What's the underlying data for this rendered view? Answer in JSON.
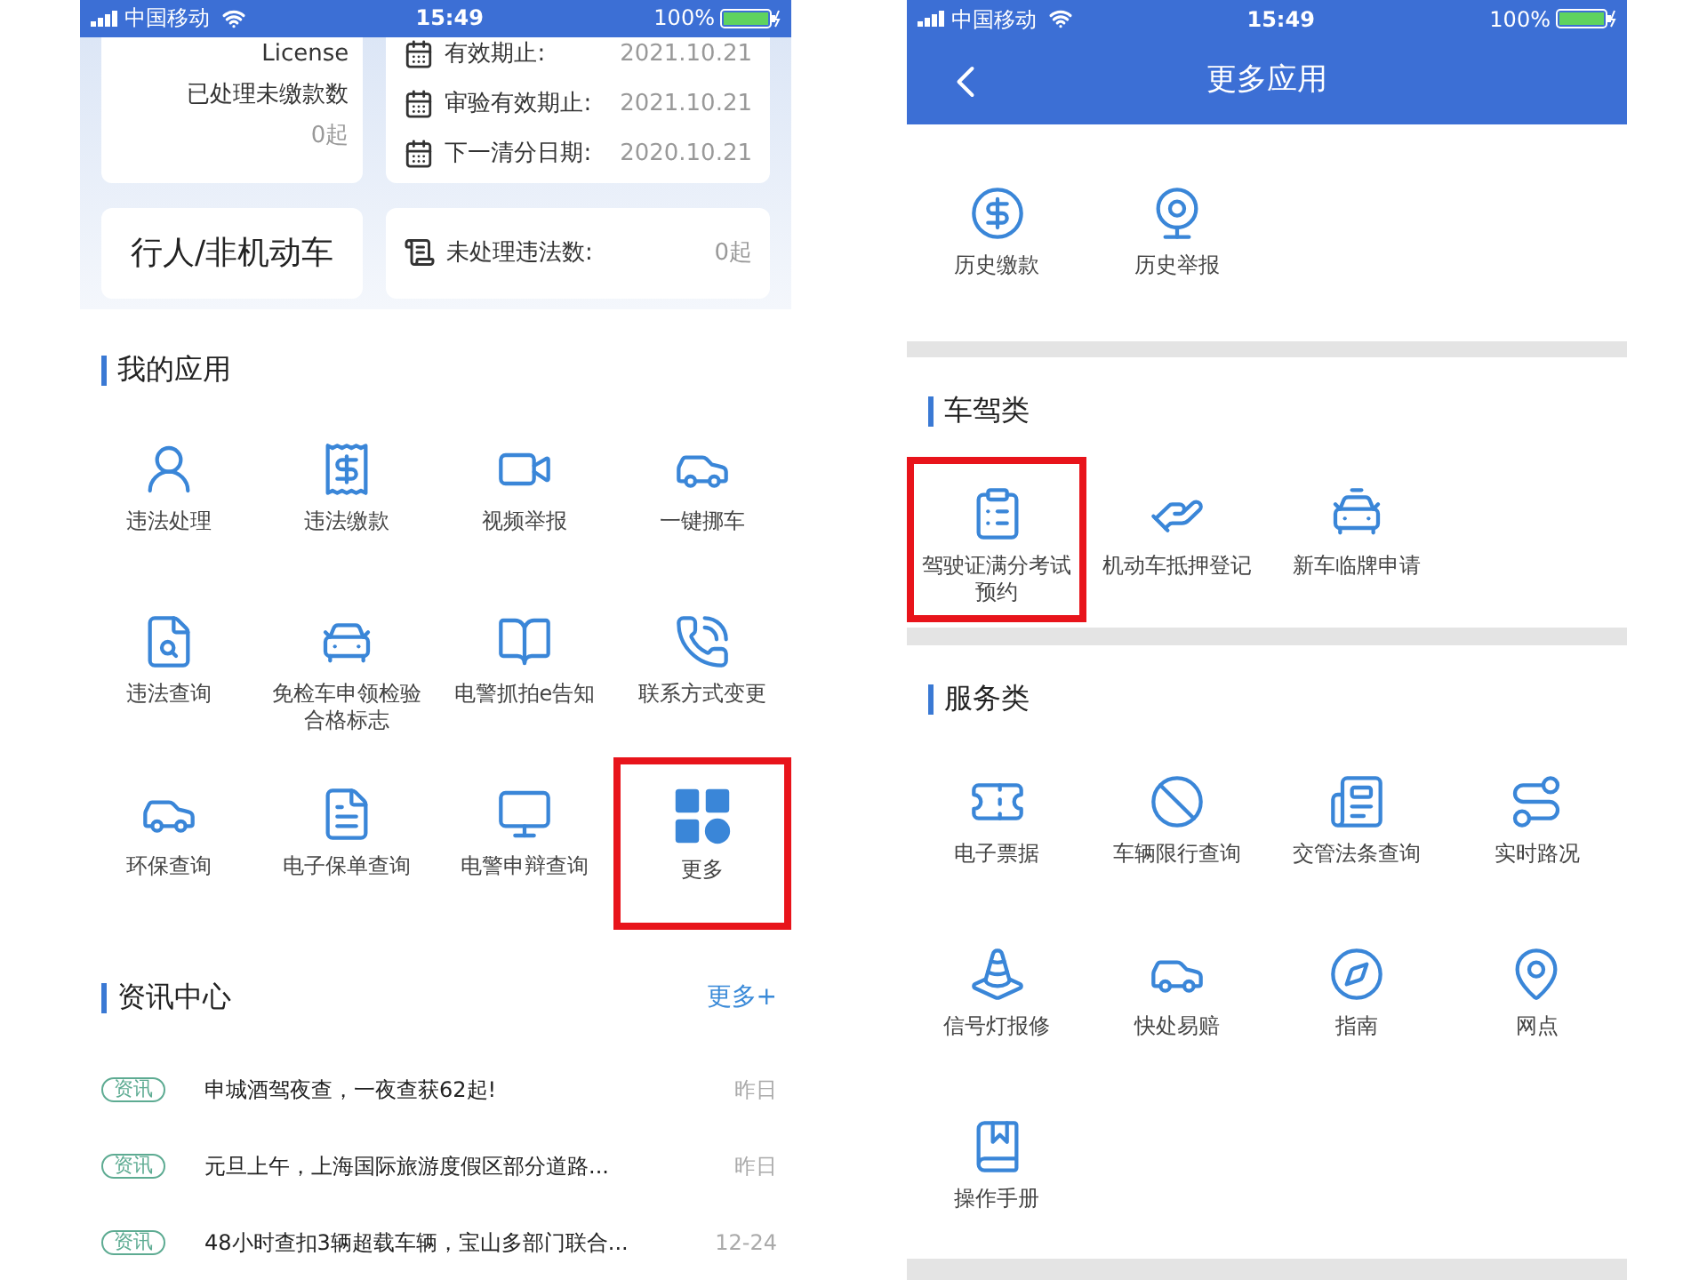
{
  "left_screen": {
    "status_bar": {
      "carrier": "中国移动",
      "time": "15:49",
      "battery": "100%"
    },
    "license_card": {
      "title": "License",
      "label": "已处理未缴款数",
      "value": "0起"
    },
    "dates_card": [
      {
        "label": "有效期止:",
        "value": "2021.10.21"
      },
      {
        "label": "审验有效期止:",
        "value": "2021.10.21"
      },
      {
        "label": "下一清分日期:",
        "value": "2020.10.21"
      }
    ],
    "pedestrian_card": {
      "label": "行人/非机动车"
    },
    "violations_card": {
      "label": "未处理违法数:",
      "value": "0起"
    },
    "my_apps": {
      "title": "我的应用",
      "items": [
        {
          "label": "违法处理",
          "highlighted": false
        },
        {
          "label": "违法缴款",
          "highlighted": false
        },
        {
          "label": "视频举报",
          "highlighted": false
        },
        {
          "label": "一键挪车",
          "highlighted": false
        },
        {
          "label": "违法查询",
          "highlighted": false
        },
        {
          "label": "免检车申领检验合格标志",
          "highlighted": false
        },
        {
          "label": "电警抓拍e告知",
          "highlighted": false
        },
        {
          "label": "联系方式变更",
          "highlighted": false
        },
        {
          "label": "环保查询",
          "highlighted": false
        },
        {
          "label": "电子保单查询",
          "highlighted": false
        },
        {
          "label": "电警申辩查询",
          "highlighted": false
        },
        {
          "label": "更多",
          "highlighted": true
        }
      ]
    },
    "news": {
      "title": "资讯中心",
      "more": "更多+",
      "items": [
        {
          "tag": "资讯",
          "title": "申城酒驾夜查，一夜查获62起!",
          "date": "昨日"
        },
        {
          "tag": "资讯",
          "title": "元旦上午，上海国际旅游度假区部分道路...",
          "date": "昨日"
        },
        {
          "tag": "资讯",
          "title": "48小时查扣3辆超载车辆，宝山多部门联合...",
          "date": "12-24"
        }
      ]
    }
  },
  "right_screen": {
    "status_bar": {
      "carrier": "中国移动",
      "time": "15:49",
      "battery": "100%"
    },
    "nav_bar": {
      "title": "更多应用"
    },
    "sections": [
      {
        "items": [
          {
            "label": "历史缴款",
            "highlighted": false
          },
          {
            "label": "历史举报",
            "highlighted": false
          }
        ]
      },
      {
        "title": "车驾类",
        "items": [
          {
            "label": "驾驶证满分考试预约",
            "highlighted": true
          },
          {
            "label": "机动车抵押登记",
            "highlighted": false
          },
          {
            "label": "新车临牌申请",
            "highlighted": false
          }
        ]
      },
      {
        "title": "服务类",
        "items": [
          {
            "label": "电子票据",
            "highlighted": false
          },
          {
            "label": "车辆限行查询",
            "highlighted": false
          },
          {
            "label": "交管法条查询",
            "highlighted": false
          },
          {
            "label": "实时路况",
            "highlighted": false
          },
          {
            "label": "信号灯报修",
            "highlighted": false
          },
          {
            "label": "快处易赔",
            "highlighted": false
          },
          {
            "label": "指南",
            "highlighted": false
          },
          {
            "label": "网点",
            "highlighted": false
          },
          {
            "label": "操作手册",
            "highlighted": false
          }
        ]
      }
    ]
  }
}
